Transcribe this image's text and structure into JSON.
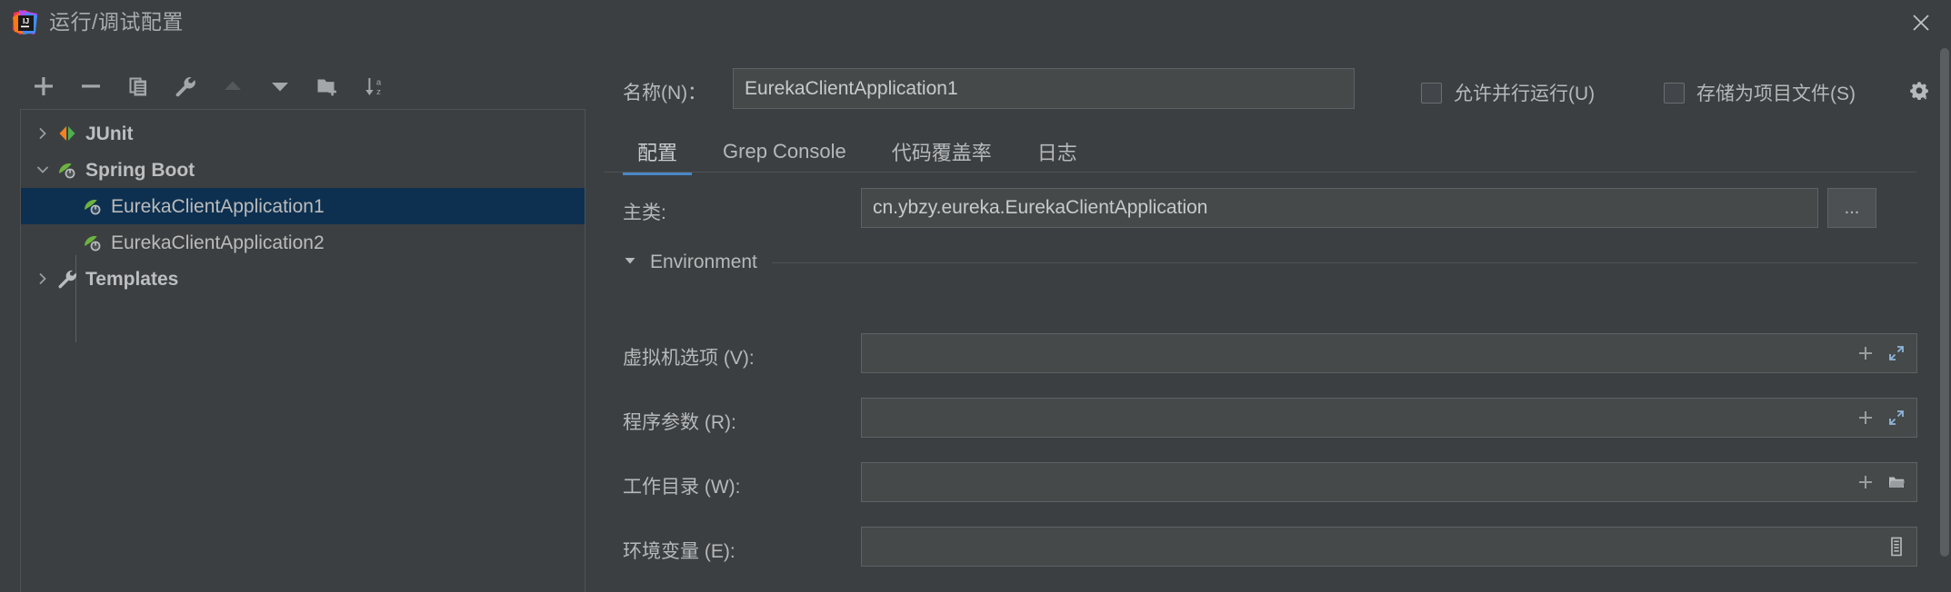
{
  "window": {
    "title": "运行/调试配置",
    "logo_icon": "intellij-idea-logo",
    "close_icon": "close-icon"
  },
  "toolbar": {
    "items": [
      {
        "name": "add-configuration-button",
        "icon": "plus-icon",
        "enabled": true
      },
      {
        "name": "remove-configuration-button",
        "icon": "minus-icon",
        "enabled": true
      },
      {
        "name": "copy-configuration-button",
        "icon": "copy-icon",
        "enabled": true
      },
      {
        "name": "edit-templates-button",
        "icon": "wrench-icon",
        "enabled": true
      },
      {
        "name": "move-up-button",
        "icon": "arrow-up-icon",
        "enabled": false
      },
      {
        "name": "move-down-button",
        "icon": "arrow-down-icon",
        "enabled": true
      },
      {
        "name": "new-folder-button",
        "icon": "new-folder-icon",
        "enabled": true
      },
      {
        "name": "sort-configurations-button",
        "icon": "sort-alpha-icon",
        "enabled": true
      }
    ]
  },
  "tree": {
    "items": [
      {
        "label": "JUnit",
        "icon": "junit-icon",
        "expanded": false,
        "level": 0,
        "selected": false,
        "bold": true
      },
      {
        "label": "Spring Boot",
        "icon": "spring-boot-icon",
        "expanded": true,
        "level": 0,
        "selected": false,
        "bold": true
      },
      {
        "label": "EurekaClientApplication1",
        "icon": "spring-boot-icon",
        "expanded": null,
        "level": 1,
        "selected": true,
        "bold": false
      },
      {
        "label": "EurekaClientApplication2",
        "icon": "spring-boot-icon",
        "expanded": null,
        "level": 1,
        "selected": false,
        "bold": false
      },
      {
        "label": "Templates",
        "icon": "wrench-icon",
        "expanded": false,
        "level": 0,
        "selected": false,
        "bold": true
      }
    ]
  },
  "form": {
    "name_label": "名称(N)：",
    "name_value": "EurekaClientApplication1",
    "allow_parallel_run": {
      "label": "允许并行运行(U)",
      "checked": false
    },
    "store_as_project_file": {
      "label": "存储为项目文件(S)",
      "checked": false
    },
    "settings_gear_icon": "gear-icon"
  },
  "tabs": [
    {
      "label": "配置",
      "active": true
    },
    {
      "label": "Grep Console",
      "active": false
    },
    {
      "label": "代码覆盖率",
      "active": false
    },
    {
      "label": "日志",
      "active": false
    }
  ],
  "main_class": {
    "label": "主类:",
    "value": "cn.ybzy.eureka.EurekaClientApplication",
    "browse_button_label": "..."
  },
  "environment": {
    "title": "Environment",
    "expanded": true,
    "collapse_icon": "triangle-down-icon",
    "rows": [
      {
        "label": "虚拟机选项 (V):",
        "value": "",
        "icons": [
          "plus-icon",
          "expand-icon"
        ]
      },
      {
        "label": "程序参数 (R):",
        "value": "",
        "icons": [
          "plus-icon",
          "expand-icon"
        ]
      },
      {
        "label": "工作目录 (W):",
        "value": "",
        "icons": [
          "plus-icon",
          "folder-icon"
        ]
      },
      {
        "label": "环境变量 (E):",
        "value": "",
        "icons": [
          "list-icon"
        ]
      }
    ]
  },
  "colors": {
    "background": "#3c3f41",
    "selection": "#0d3050",
    "accent": "#4a88c7",
    "field_bg": "#45494a",
    "border": "#5e6264",
    "text": "#b6b8ba"
  }
}
